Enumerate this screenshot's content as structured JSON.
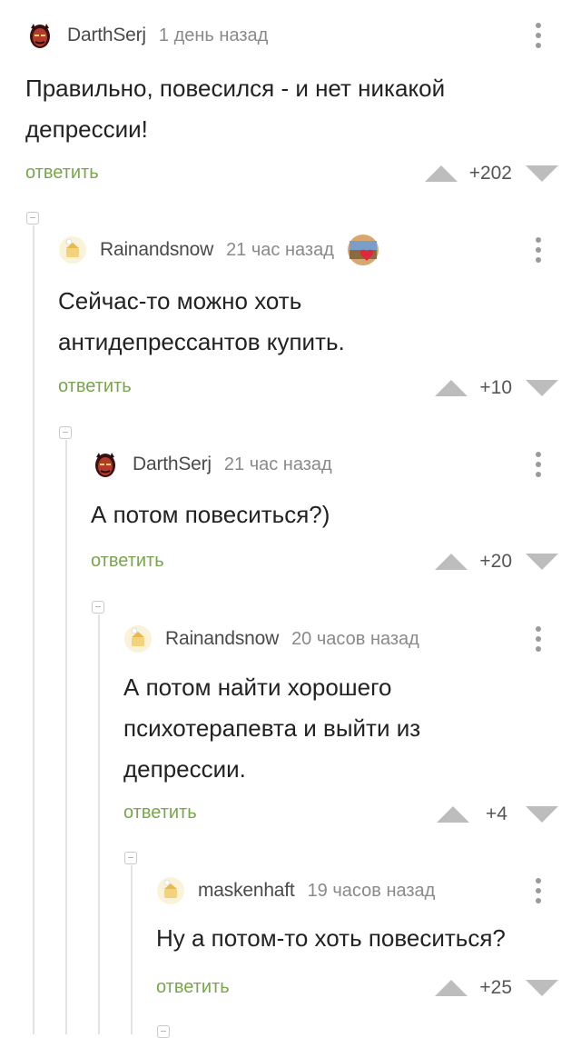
{
  "comments": [
    {
      "author": "DarthSerj",
      "time": "1 день назад",
      "avatar": "devil-avatar-icon",
      "text_lines": [
        "Правильно, повесился - и нет никакой",
        "депрессии!"
      ],
      "reply_label": "ответить",
      "rating": "+202"
    },
    {
      "author": "Rainandsnow",
      "time": "21 час назад",
      "avatar": "placeholder-avatar-icon",
      "award": "heart-award-icon",
      "text_lines": [
        "Сейчас-то можно хоть",
        "антидепрессантов купить."
      ],
      "reply_label": "ответить",
      "rating": "+10"
    },
    {
      "author": "DarthSerj",
      "time": "21 час назад",
      "avatar": "devil-avatar-icon",
      "text_lines": [
        "А потом повеситься?)"
      ],
      "reply_label": "ответить",
      "rating": "+20"
    },
    {
      "author": "Rainandsnow",
      "time": "20 часов назад",
      "avatar": "placeholder-avatar-icon",
      "text_lines": [
        "А потом найти хорошего",
        "психотерапевта и выйти из",
        "депрессии."
      ],
      "reply_label": "ответить",
      "rating": "+4"
    },
    {
      "author": "maskenhaft",
      "time": "19 часов назад",
      "avatar": "placeholder-avatar-icon",
      "text_lines": [
        "Ну а потом-то хоть повеситься?"
      ],
      "reply_label": "ответить",
      "rating": "+25"
    }
  ],
  "colors": {
    "reply_link": "#79a54e",
    "thread_line": "#e3e3e3",
    "vote_arrow": "#bdbdbd"
  }
}
